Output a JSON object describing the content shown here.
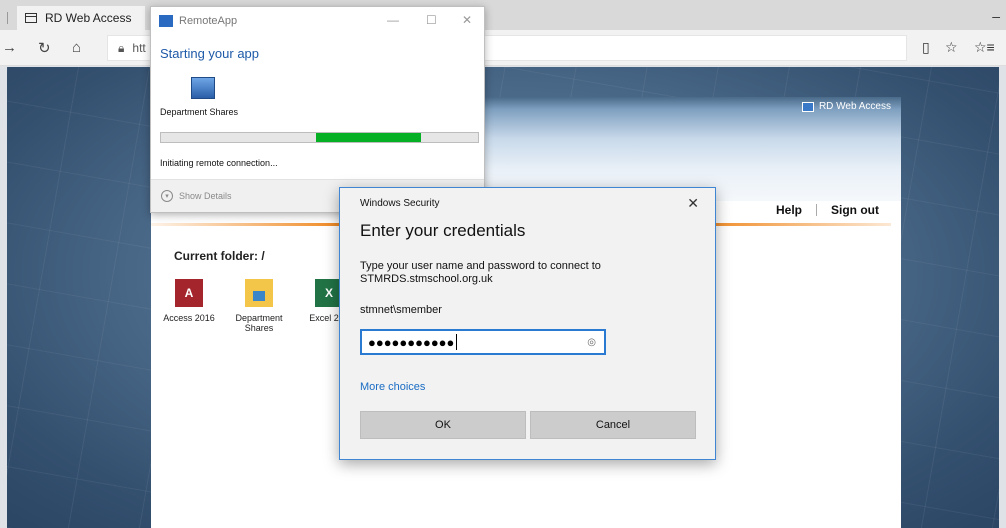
{
  "browser": {
    "tab_title": "RD Web Access",
    "address_prefix": "htt",
    "minimize_glyph": "–",
    "back_glyph": "→",
    "refresh_glyph": "↻",
    "home_glyph": "⌂",
    "reading_glyph": "▯",
    "favorite_glyph": "☆",
    "hub_glyph": "☆≡"
  },
  "rdweb": {
    "brand": "RD Web Access",
    "links": {
      "help": "Help",
      "signout": "Sign out"
    },
    "folder_label": "Current folder: /",
    "apps": [
      {
        "label": "Access 2016",
        "icon": "access-icon",
        "glyph": "A"
      },
      {
        "label": "Department Shares",
        "icon": "folder-icon",
        "glyph": ""
      },
      {
        "label": "Excel 201",
        "icon": "excel-icon",
        "glyph": "X"
      }
    ]
  },
  "remoteapp": {
    "window_title": "RemoteApp",
    "heading": "Starting your app",
    "app_name": "Department Shares",
    "status": "Initiating remote connection...",
    "details_label": "Show Details",
    "progress": {
      "start": 0.49,
      "end": 0.82
    },
    "controls": {
      "minimize": "—",
      "maximize": "☐",
      "close": "✕"
    }
  },
  "security_dialog": {
    "title": "Windows Security",
    "heading": "Enter your credentials",
    "message": "Type your user name and password to connect to STMRDS.stmschool.org.uk",
    "username": "stmnet\\smember",
    "password_mask": "●●●●●●●●●●●",
    "more_choices": "More choices",
    "ok_label": "OK",
    "cancel_label": "Cancel",
    "close_glyph": "✕",
    "reveal_glyph": "◎"
  },
  "colors": {
    "accent_blue": "#1a6cc4",
    "progress_green": "#06b025",
    "rd_orange": "#f08c28"
  }
}
